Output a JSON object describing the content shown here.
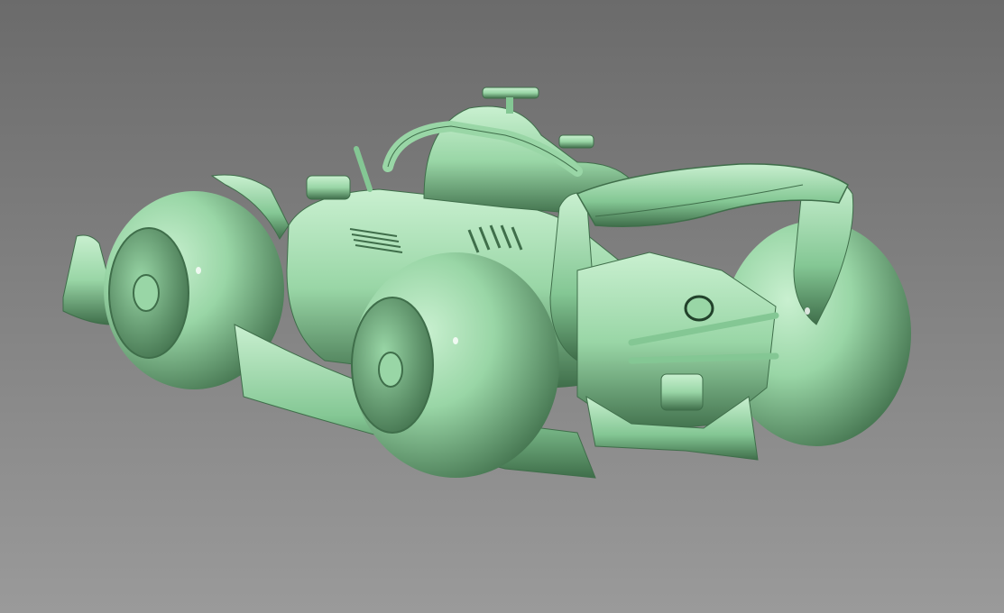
{
  "viewport": {
    "subject": "f1-car-clay-render",
    "background_top_color": "#6b6b6b",
    "background_bottom_color": "#9a9a9a",
    "model_base_color": "#99d6a6",
    "model_light_color": "#c9f0d0",
    "model_mid_color": "#84c794",
    "model_shadow_color": "#3f6e4a",
    "model_deep_shadow_color": "#22422b"
  }
}
